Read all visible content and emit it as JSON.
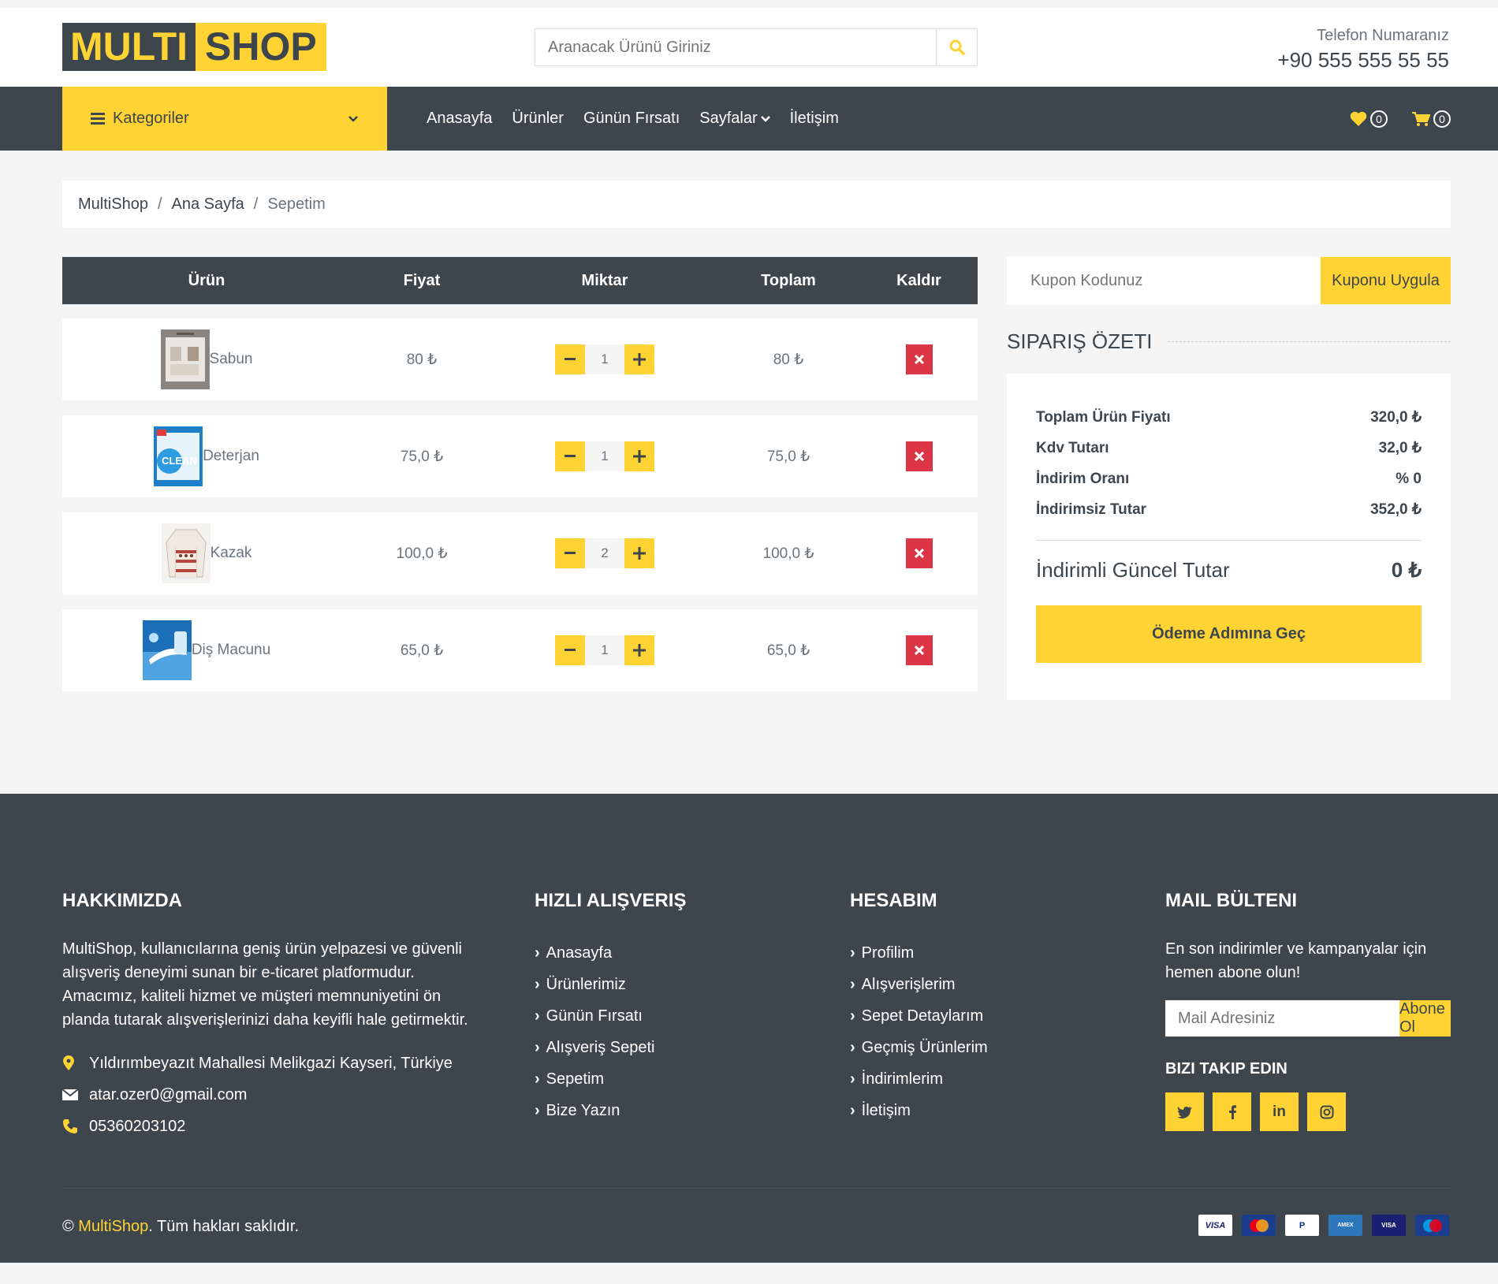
{
  "header": {
    "logo_part1": "MULTI",
    "logo_part2": "SHOP",
    "search_placeholder": "Aranacak Ürünü Giriniz",
    "phone_label": "Telefon Numaranız",
    "phone_number": "+90 555 555 55 55"
  },
  "nav": {
    "categories": "Kategoriler",
    "links": [
      "Anasayfa",
      "Ürünler",
      "Günün Fırsatı",
      "Sayfalar",
      "İletişim"
    ],
    "wishlist_count": "0",
    "cart_count": "0"
  },
  "breadcrumb": [
    "MultiShop",
    "Ana Sayfa",
    "Sepetim"
  ],
  "cart": {
    "headers": [
      "Ürün",
      "Fiyat",
      "Miktar",
      "Toplam",
      "Kaldır"
    ],
    "items": [
      {
        "name": "Sabun",
        "price": "80 ₺",
        "qty": "1",
        "total": "80 ₺",
        "icon": "soap-product-image"
      },
      {
        "name": "Deterjan",
        "price": "75,0 ₺",
        "qty": "1",
        "total": "75,0 ₺",
        "icon": "detergent-product-image"
      },
      {
        "name": "Kazak",
        "price": "100,0 ₺",
        "qty": "2",
        "total": "100,0 ₺",
        "icon": "sweater-product-image"
      },
      {
        "name": "Diş Macunu",
        "price": "65,0 ₺",
        "qty": "1",
        "total": "65,0 ₺",
        "icon": "toothpaste-product-image"
      }
    ]
  },
  "coupon": {
    "placeholder": "Kupon Kodunuz",
    "button": "Kuponu Uygula"
  },
  "summary": {
    "title": "SIPARIŞ ÖZETI",
    "lines": [
      {
        "label": "Toplam Ürün Fiyatı",
        "value": "320,0 ₺"
      },
      {
        "label": "Kdv Tutarı",
        "value": "32,0 ₺"
      },
      {
        "label": "İndirim Oranı",
        "value": "% 0"
      },
      {
        "label": "İndirimsiz Tutar",
        "value": "352,0 ₺"
      }
    ],
    "total_label": "İndirimli Güncel Tutar",
    "total_value": "0 ₺",
    "pay_button": "Ödeme Adımına Geç"
  },
  "footer": {
    "about": {
      "title": "HAKKIMIZDA",
      "text": "MultiShop, kullanıcılarına geniş ürün yelpazesi ve güvenli alışveriş deneyimi sunan bir e-ticaret platformudur. Amacımız, kaliteli hizmet ve müşteri memnuniyetini ön planda tutarak alışverişlerinizi daha keyifli hale getirmektir.",
      "address": "Yıldırımbeyazıt Mahallesi Melikgazi Kayseri, Türkiye",
      "email": "atar.ozer0@gmail.com",
      "phone": "05360203102"
    },
    "quick": {
      "title": "HIZLI ALIŞVERIŞ",
      "links": [
        "Anasayfa",
        "Ürünlerimiz",
        "Günün Fırsatı",
        "Alışveriş Sepeti",
        "Sepetim",
        "Bize Yazın"
      ]
    },
    "account": {
      "title": "HESABIM",
      "links": [
        "Profilim",
        "Alışverişlerim",
        "Sepet Detaylarım",
        "Geçmiş Ürünlerim",
        "İndirimlerim",
        "İletişim"
      ]
    },
    "newsletter": {
      "title": "MAIL BÜLTENI",
      "text": "En son indirimler ve kampanyalar için hemen abone olun!",
      "placeholder": "Mail Adresiniz",
      "button": "Abone Ol",
      "follow": "BIZI TAKIP EDIN"
    },
    "copyright_prefix": "© ",
    "copyright_brand": "MultiShop",
    "copyright_suffix": ". Tüm hakları saklıdır.",
    "payment_icons": [
      "visa-icon",
      "mastercard-icon",
      "paypal-icon",
      "amex-icon",
      "visa-electron-icon",
      "maestro-icon"
    ]
  },
  "colors": {
    "accent": "#ffd333",
    "dark": "#3d464d",
    "danger": "#dc3545"
  }
}
